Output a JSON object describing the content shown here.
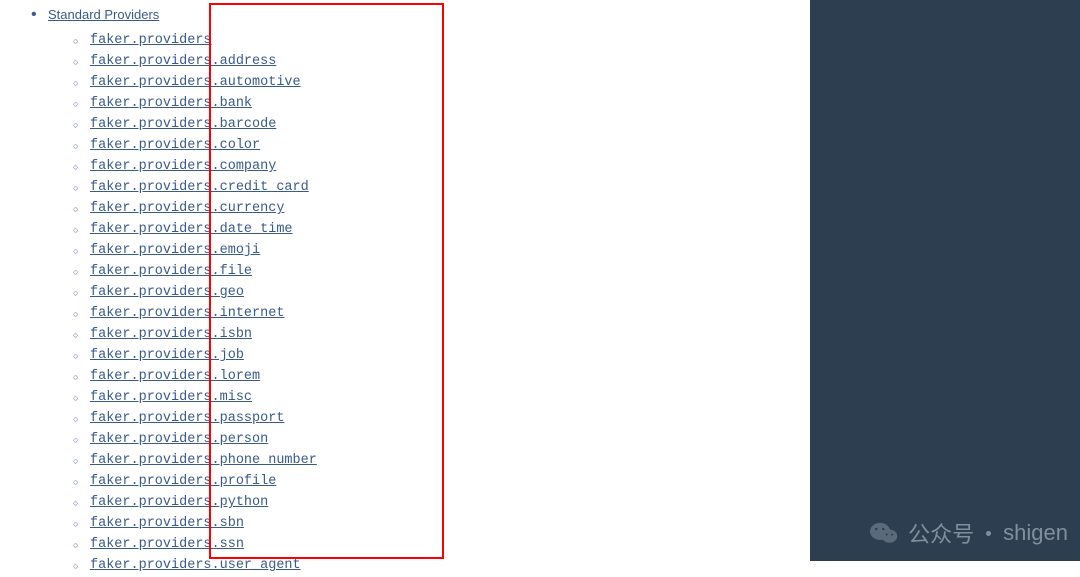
{
  "heading": "Standard Providers",
  "prefix": "faker.providers",
  "modules": [
    "",
    "address",
    "automotive",
    "bank",
    "barcode",
    "color",
    "company",
    "credit_card",
    "currency",
    "date_time",
    "emoji",
    "file",
    "geo",
    "internet",
    "isbn",
    "job",
    "lorem",
    "misc",
    "passport",
    "person",
    "phone_number",
    "profile",
    "python",
    "sbn",
    "ssn",
    "user_agent"
  ],
  "watermark": {
    "label": "公众号",
    "name": "shigen"
  }
}
